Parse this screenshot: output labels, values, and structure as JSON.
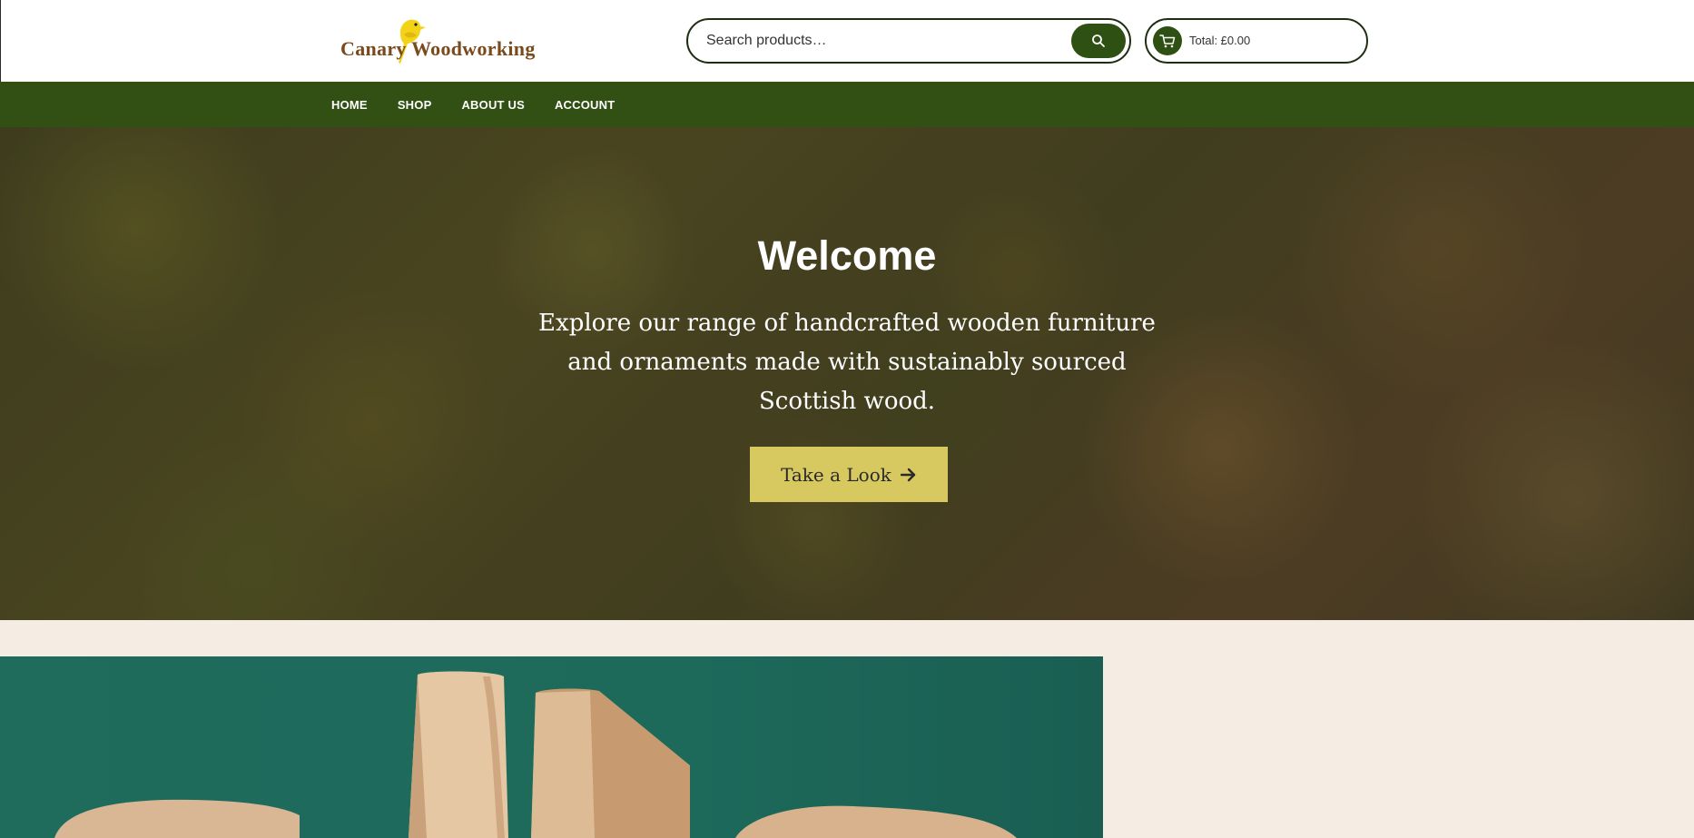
{
  "header": {
    "logo_text": "Canary Woodworking",
    "search": {
      "placeholder": "Search products…"
    },
    "cart": {
      "total": "Total: £0.00"
    }
  },
  "nav": {
    "items": [
      {
        "label": "HOME"
      },
      {
        "label": "SHOP"
      },
      {
        "label": "ABOUT US"
      },
      {
        "label": "ACCOUNT"
      }
    ]
  },
  "hero": {
    "title": "Welcome",
    "subtitle": "Explore our range of handcrafted wooden furniture and ornaments made with sustainably sourced Scottish wood.",
    "button_label": "Take a Look"
  },
  "icons": {
    "logo": "canary-bird-icon",
    "search": "search-icon",
    "cart": "cart-icon",
    "cta": "arrow-right-icon"
  },
  "colors": {
    "brand_green": "#325013",
    "accent_yellow": "#d8c860",
    "logo_brown": "#7a4a1c",
    "page_background": "#f5ece4"
  }
}
